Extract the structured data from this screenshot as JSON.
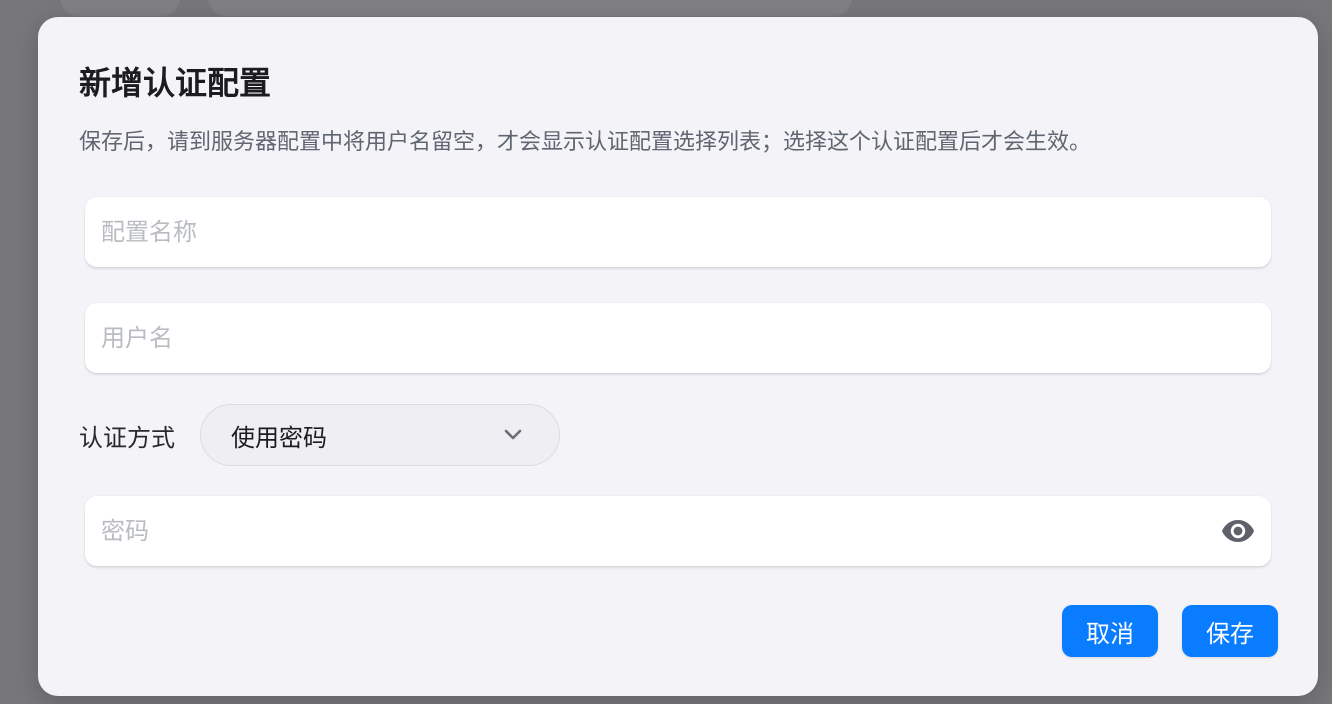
{
  "dialog": {
    "title": "新增认证配置",
    "description": "保存后，请到服务器配置中将用户名留空，才会显示认证配置选择列表；选择这个认证配置后才会生效。"
  },
  "form": {
    "config_name": {
      "value": "",
      "placeholder": "配置名称"
    },
    "username": {
      "value": "",
      "placeholder": "用户名"
    },
    "auth_method": {
      "label": "认证方式",
      "selected": "使用密码"
    },
    "password": {
      "value": "",
      "placeholder": "密码",
      "toggle_icon": "eye-icon"
    }
  },
  "actions": {
    "cancel_label": "取消",
    "save_label": "保存"
  },
  "colors": {
    "accent": "#0a7cff",
    "dialog_background": "#f4f3f7",
    "overlay": "#77767b"
  }
}
